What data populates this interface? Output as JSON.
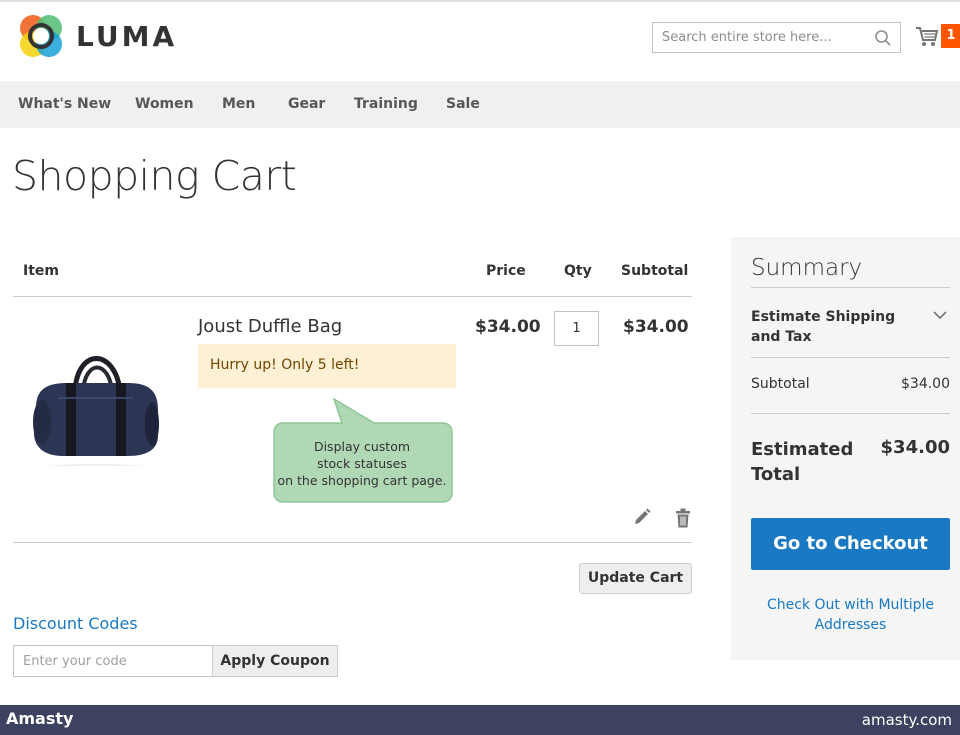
{
  "header": {
    "logo_text": "LUMA",
    "search_placeholder": "Search entire store here...",
    "cart_count": "1"
  },
  "nav": {
    "items": [
      "What's New",
      "Women",
      "Men",
      "Gear",
      "Training",
      "Sale"
    ]
  },
  "page": {
    "title": "Shopping Cart"
  },
  "cart": {
    "headers": {
      "item": "Item",
      "price": "Price",
      "qty": "Qty",
      "subtotal": "Subtotal"
    },
    "items": [
      {
        "name": "Joust Duffle Bag",
        "stock_status": "Hurry up! Only 5 left!",
        "price": "$34.00",
        "qty": "1",
        "subtotal": "$34.00"
      }
    ],
    "update_label": "Update Cart"
  },
  "callout": {
    "lines": [
      "Display custom",
      "stock statuses",
      "on the shopping cart page."
    ]
  },
  "discount": {
    "title": "Discount Codes",
    "placeholder": "Enter your code",
    "apply_label": "Apply Coupon"
  },
  "summary": {
    "title": "Summary",
    "shipping_label": "Estimate Shipping and Tax",
    "subtotal_label": "Subtotal",
    "subtotal_value": "$34.00",
    "total_label": "Estimated Total",
    "total_value": "$34.00",
    "checkout_label": "Go to Checkout",
    "multi_label": "Check Out with Multiple Addresses"
  },
  "footer": {
    "brand": "Amasty",
    "url": "amasty.com"
  },
  "colors": {
    "accent": "#1979c3",
    "cart_badge": "#ff5501",
    "stock_bg": "#fdf0d5",
    "callout_bg": "#b1d8b4",
    "footer_bg": "#3d4260"
  }
}
